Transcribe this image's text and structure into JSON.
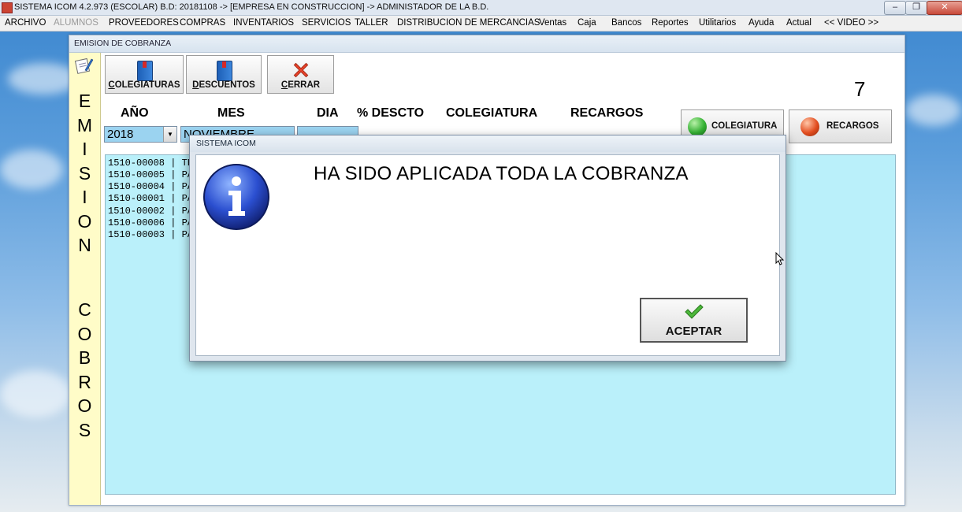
{
  "window": {
    "title": "SISTEMA ICOM 4.2.973 (ESCOLAR)  B.D: 20181108  ->  [EMPRESA EN CONSTRUCCION]  ->  ADMINISTADOR DE LA B.D.",
    "controls": {
      "minimize": "–",
      "maximize": "❐",
      "close": "✕"
    }
  },
  "menu": [
    {
      "label": "ARCHIVO",
      "enabled": true
    },
    {
      "label": "ALUMNOS",
      "enabled": false
    },
    {
      "label": "PROVEEDORES",
      "enabled": true
    },
    {
      "label": "COMPRAS",
      "enabled": true
    },
    {
      "label": "INVENTARIOS",
      "enabled": true
    },
    {
      "label": "SERVICIOS",
      "enabled": true
    },
    {
      "label": "TALLER",
      "enabled": true
    },
    {
      "label": "DISTRIBUCION DE MERCANCIAS",
      "enabled": true
    },
    {
      "label": "Ventas",
      "enabled": true
    },
    {
      "label": "Caja",
      "enabled": true
    },
    {
      "label": "Bancos",
      "enabled": true
    },
    {
      "label": "Reportes",
      "enabled": true
    },
    {
      "label": "Utilitarios",
      "enabled": true
    },
    {
      "label": "Ayuda",
      "enabled": true
    },
    {
      "label": "Actual",
      "enabled": true
    },
    {
      "label": "<< VIDEO >>",
      "enabled": true
    }
  ],
  "form": {
    "title": "EMISION DE COBRANZA",
    "side_label_1": "E\nM\nI\nS\nI\nO\nN",
    "side_label_2": "C\nO\nB\nR\nO\nS",
    "toolbar": {
      "colegiaturas": "COLEGIATURAS",
      "descuentos": "DESCUENTOS",
      "cerrar": "CERRAR"
    },
    "counter": "7",
    "headers": {
      "anio": "AÑO",
      "mes": "MES",
      "dia": "DIA",
      "descto": "% DESCTO",
      "colegiatura": "COLEGIATURA",
      "recargos": "RECARGOS"
    },
    "fields": {
      "anio_value": "2018",
      "mes_value": "NOVIEMBRE"
    },
    "status_buttons": {
      "colegiatura": "COLEGIATURA",
      "recargos": "RECARGOS"
    },
    "rows": [
      "1510-00008 | TE",
      "1510-00005 | PA",
      "1510-00004 | PA",
      "1510-00001 | PA",
      "1510-00002 | PA",
      "1510-00006 | PA",
      "1510-00003 | PA"
    ]
  },
  "dialog": {
    "title": "SISTEMA ICOM",
    "message": "HA SIDO APLICADA TODA LA COBRANZA",
    "ok_button": "ACEPTAR"
  },
  "colors": {
    "list_bg": "#baf0fa",
    "side_bar": "#fffcc8",
    "combo_bg": "#9bd3f0",
    "status_green": "#34b233",
    "status_red": "#e24d1f"
  },
  "icons": {
    "colegiaturas": "book-icon",
    "descuentos": "book-icon",
    "cerrar": "red-x-icon",
    "dialog": "info-icon",
    "ok": "checkmark-icon"
  }
}
